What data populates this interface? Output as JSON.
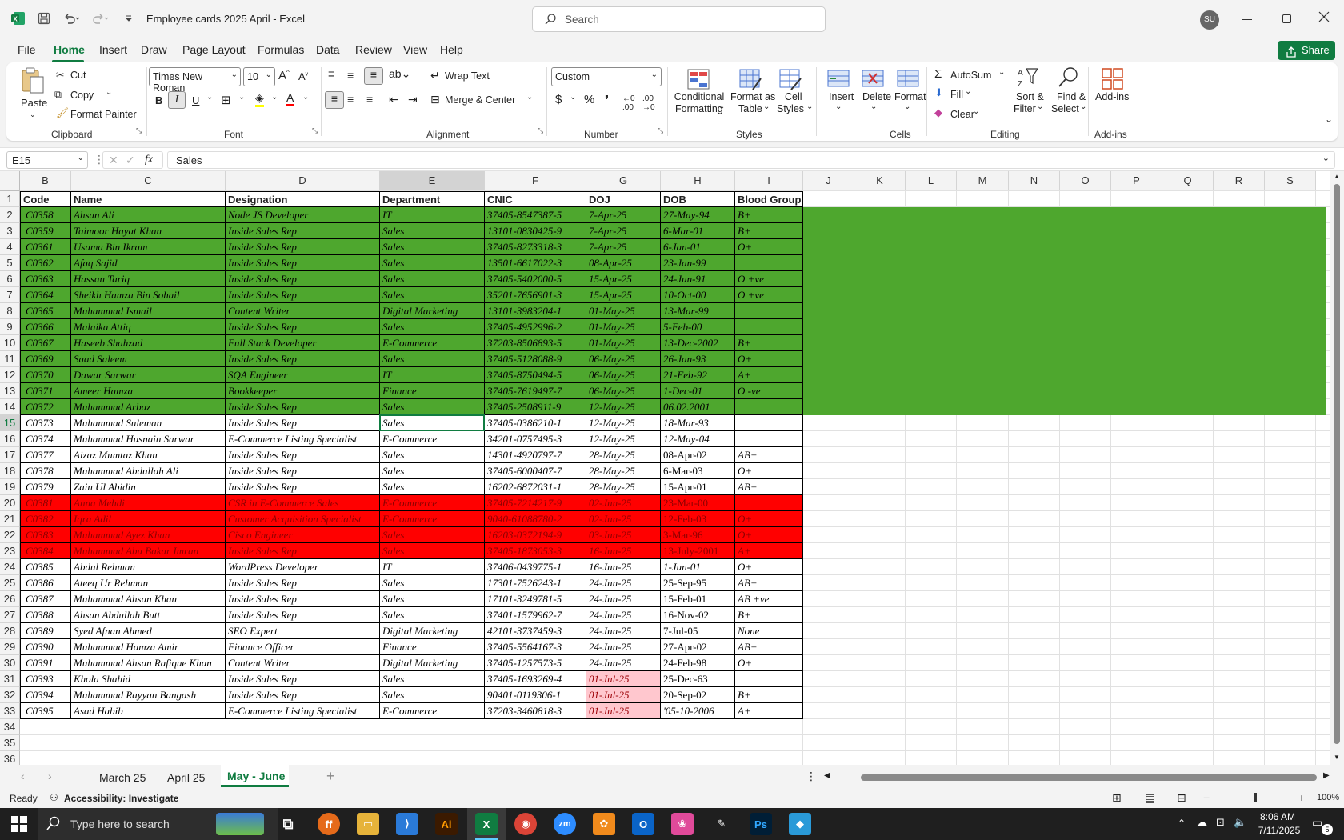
{
  "titlebar": {
    "title": "Employee cards 2025 April  -  Excel",
    "search_placeholder": "Search",
    "avatar": "SU"
  },
  "menu": [
    "File",
    "Home",
    "Insert",
    "Draw",
    "Page Layout",
    "Formulas",
    "Data",
    "Review",
    "View",
    "Help"
  ],
  "share_label": "Share",
  "ribbon": {
    "clipboard": {
      "paste": "Paste",
      "cut": "Cut",
      "copy": "Copy",
      "format_painter": "Format Painter",
      "label": "Clipboard"
    },
    "font": {
      "name": "Times New Roman",
      "size": "10",
      "label": "Font"
    },
    "alignment": {
      "wrap": "Wrap Text",
      "merge": "Merge & Center",
      "label": "Alignment"
    },
    "number": {
      "format": "Custom",
      "label": "Number"
    },
    "styles": {
      "conditional": "Conditional",
      "conditional2": "Formatting",
      "format_table": "Format as",
      "format_table2": "Table",
      "cell_styles": "Cell",
      "cell_styles2": "Styles",
      "label": "Styles"
    },
    "cells": {
      "insert": "Insert",
      "delete": "Delete",
      "format": "Format",
      "label": "Cells"
    },
    "editing": {
      "autosum": "AutoSum",
      "fill": "Fill",
      "clear": "Clear",
      "sort": "Sort &",
      "sort2": "Filter",
      "find": "Find &",
      "find2": "Select",
      "label": "Editing"
    },
    "addins": {
      "btn": "Add-ins",
      "label": "Add-ins"
    }
  },
  "formula_bar": {
    "name_box": "E15",
    "fx": "fx",
    "value": "Sales"
  },
  "columns": [
    "B",
    "C",
    "D",
    "E",
    "F",
    "G",
    "H",
    "I",
    "J",
    "K",
    "L",
    "M",
    "N",
    "O",
    "P",
    "Q",
    "R",
    "S"
  ],
  "headers": [
    "Code",
    "Name",
    "Designation",
    "Department",
    "CNIC",
    "DOJ",
    "DOB",
    "Blood Group"
  ],
  "rows": [
    [
      "C0358",
      "Ahsan Ali",
      "Node JS Developer",
      "IT",
      "37405-8547387-5",
      "7-Apr-25",
      "27-May-94",
      "B+"
    ],
    [
      "C0359",
      "Taimoor Hayat Khan",
      "Inside Sales Rep",
      "Sales",
      "13101-0830425-9",
      "7-Apr-25",
      "6-Mar-01",
      "B+"
    ],
    [
      "C0361",
      "Usama Bin Ikram",
      "Inside Sales Rep",
      "Sales",
      "37405-8273318-3",
      "7-Apr-25",
      "6-Jan-01",
      "O+"
    ],
    [
      "C0362",
      "Afaq Sajid",
      "Inside Sales Rep",
      "Sales",
      "13501-6617022-3",
      "08-Apr-25",
      "23-Jan-99",
      ""
    ],
    [
      "C0363",
      "Hassan Tariq",
      "Inside Sales Rep",
      "Sales",
      "37405-5402000-5",
      "15-Apr-25",
      "24-Jun-91",
      "O +ve"
    ],
    [
      "C0364",
      "Sheikh Hamza Bin Sohail",
      "Inside Sales Rep",
      "Sales",
      "35201-7656901-3",
      "15-Apr-25",
      "10-Oct-00",
      "O +ve"
    ],
    [
      "C0365",
      "Muhammad Ismail",
      "Content Writer",
      "Digital Marketing",
      "13101-3983204-1",
      "01-May-25",
      "13-Mar-99",
      ""
    ],
    [
      "C0366",
      "Malaika Attiq",
      "Inside Sales Rep",
      "Sales",
      "37405-4952996-2",
      "01-May-25",
      "5-Feb-00",
      ""
    ],
    [
      "C0367",
      "Haseeb Shahzad",
      "Full Stack Developer",
      "E-Commerce",
      "37203-8506893-5",
      "01-May-25",
      "13-Dec-2002",
      "B+"
    ],
    [
      "C0369",
      "Saad Saleem",
      "Inside Sales Rep",
      "Sales",
      "37405-5128088-9",
      "06-May-25",
      "26-Jan-93",
      "O+"
    ],
    [
      "C0370",
      "Dawar Sarwar",
      "SQA Engineer",
      "IT",
      "37405-8750494-5",
      "06-May-25",
      "21-Feb-92",
      "A+"
    ],
    [
      "C0371",
      "Ameer Hamza",
      "Bookkeeper",
      "Finance",
      "37405-7619497-7",
      "06-May-25",
      "1-Dec-01",
      "O -ve"
    ],
    [
      "C0372",
      "Muhammad Arbaz",
      "Inside Sales Rep",
      "Sales",
      "37405-2508911-9",
      "12-May-25",
      "06.02.2001",
      ""
    ],
    [
      "C0373",
      "Muhammad Suleman",
      "Inside Sales Rep",
      "Sales",
      "37405-0386210-1",
      "12-May-25",
      "18-Mar-93",
      ""
    ],
    [
      "C0374",
      "Muhammad Husnain Sarwar",
      "E-Commerce Listing Specialist",
      "E-Commerce",
      "34201-0757495-3",
      "12-May-25",
      "12-May-04",
      ""
    ],
    [
      "C0377",
      "Aizaz Mumtaz Khan",
      "Inside Sales Rep",
      "Sales",
      "14301-4920797-7",
      "28-May-25",
      "08-Apr-02",
      "AB+"
    ],
    [
      "C0378",
      "Muhammad Abdullah Ali",
      "Inside Sales Rep",
      "Sales",
      "37405-6000407-7",
      "28-May-25",
      "6-Mar-03",
      "O+"
    ],
    [
      "C0379",
      "Zain Ul Abidin",
      "Inside Sales Rep",
      "Sales",
      "16202-6872031-1",
      "28-May-25",
      "15-Apr-01",
      "AB+"
    ],
    [
      "C0381",
      "Anna Mehdi",
      "CSR in E-Commerce Sales",
      "E-Commerce",
      "37405-7214217-9",
      "02-Jun-25",
      "23-Mar-00",
      ""
    ],
    [
      "C0382",
      "Iqra Adil",
      "Customer Acquisition Specialist",
      "E-Commerce",
      "9040-61088780-2",
      "02-Jun-25",
      "12-Feb-03",
      "O+"
    ],
    [
      "C0383",
      "Muhammad Ayez Khan",
      "Cisco Engineer",
      "Sales",
      "16203-0372194-9",
      "03-Jun-25",
      "3-Mar-96",
      "O+"
    ],
    [
      "C0384",
      "Muhammad Abu Bakar Imran",
      "Inside Sales Rep",
      "Sales",
      "37405-1873053-3",
      "16-Jun-25",
      "13-July-2001",
      "A+"
    ],
    [
      "C0385",
      "Abdul Rehman",
      "WordPress Developer",
      "IT",
      "37406-0439775-1",
      "16-Jun-25",
      "1-Jun-01",
      "O+"
    ],
    [
      "C0386",
      "Ateeq Ur Rehman",
      "Inside Sales Rep",
      "Sales",
      "17301-7526243-1",
      "24-Jun-25",
      "25-Sep-95",
      "AB+"
    ],
    [
      "C0387",
      "Muhammad Ahsan Khan",
      "Inside Sales Rep",
      "Sales",
      "17101-3249781-5",
      "24-Jun-25",
      "15-Feb-01",
      "AB +ve"
    ],
    [
      "C0388",
      "Ahsan Abdullah Butt",
      "Inside Sales Rep",
      "Sales",
      "37401-1579962-7",
      "24-Jun-25",
      "16-Nov-02",
      "B+"
    ],
    [
      "C0389",
      "Syed Afnan Ahmed",
      "SEO Expert",
      "Digital Marketing",
      "42101-3737459-3",
      "24-Jun-25",
      "7-Jul-05",
      "None"
    ],
    [
      "C0390",
      "Muhammad Hamza Amir",
      "Finance Officer",
      "Finance",
      "37405-5564167-3",
      "24-Jun-25",
      "27-Apr-02",
      "AB+"
    ],
    [
      "C0391",
      "Muhammad Ahsan Rafique Khan",
      "Content Writer",
      "Digital Marketing",
      "37405-1257573-5",
      "24-Jun-25",
      "24-Feb-98",
      "O+"
    ],
    [
      "C0393",
      "Khola Shahid",
      "Inside Sales Rep",
      "Sales",
      "37405-1693269-4",
      "01-Jul-25",
      "25-Dec-63",
      ""
    ],
    [
      "C0394",
      "Muhammad Rayyan Bangash",
      "Inside Sales Rep",
      "Sales",
      "90401-0119306-1",
      "01-Jul-25",
      "20-Sep-02",
      "B+"
    ],
    [
      "C0395",
      "Asad Habib",
      "E-Commerce Listing Specialist",
      "E-Commerce",
      "37203-3460818-3",
      "01-Jul-25",
      "'05-10-2006",
      "A+"
    ]
  ],
  "row_numbers": [
    "1",
    "2",
    "3",
    "4",
    "5",
    "6",
    "7",
    "8",
    "9",
    "10",
    "11",
    "12",
    "13",
    "14",
    "15",
    "16",
    "17",
    "18",
    "19",
    "20",
    "21",
    "22",
    "23",
    "24",
    "25",
    "26",
    "27",
    "28",
    "29",
    "30",
    "31",
    "32",
    "33",
    "34",
    "35",
    "36"
  ],
  "sheet_tabs": [
    "March 25",
    "April 25",
    "May - June"
  ],
  "status": {
    "ready": "Ready",
    "accessibility": "Accessibility: Investigate",
    "zoom": "100%"
  },
  "taskbar": {
    "search_placeholder": "Type here to search",
    "time": "8:06 AM",
    "date": "7/11/2025",
    "notifications": "5"
  },
  "colors": {
    "green": "#4ea72e",
    "red": "#ff0000",
    "pink": "#ffc7ce",
    "excel": "#107c41"
  }
}
